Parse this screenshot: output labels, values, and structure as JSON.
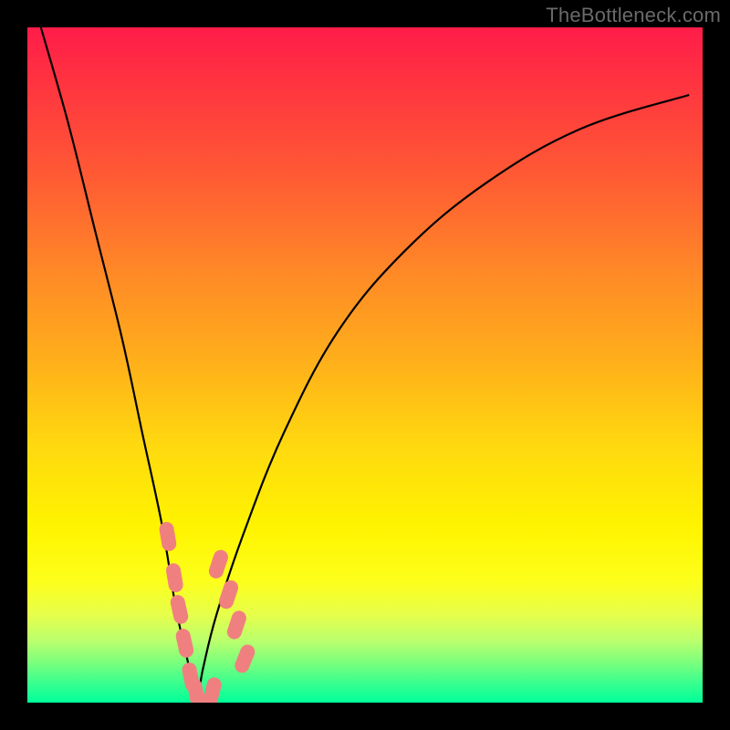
{
  "watermark": "TheBottleneck.com",
  "colors": {
    "background_frame": "#000000",
    "gradient_top": "#ff1c49",
    "gradient_bottom": "#00ff99",
    "curve": "#000000",
    "bead": "#f08080"
  },
  "chart_data": {
    "type": "line",
    "title": "",
    "xlabel": "",
    "ylabel": "",
    "xlim": [
      0,
      100
    ],
    "ylim": [
      0,
      100
    ],
    "grid": false,
    "note": "No numeric tick labels are shown; x/y coordinates are estimated on a 0–100 normalized scale. Minimum of the V-shaped curve is near x≈25 (curve touches bottom).",
    "series": [
      {
        "name": "bottleneck-curve",
        "x": [
          2,
          6,
          10,
          14,
          17,
          20,
          22,
          24,
          25,
          26,
          28,
          32,
          38,
          46,
          56,
          68,
          82,
          98
        ],
        "y": [
          100,
          86,
          70,
          54,
          40,
          26,
          14,
          5,
          0,
          5,
          13,
          25,
          40,
          55,
          67,
          77,
          85,
          90
        ]
      }
    ],
    "markers": [
      {
        "name": "left-arm-beads",
        "shape": "rounded-rect",
        "points": [
          {
            "x": 20.8,
            "y": 24.6
          },
          {
            "x": 21.8,
            "y": 18.5
          },
          {
            "x": 22.5,
            "y": 13.8
          },
          {
            "x": 23.3,
            "y": 8.8
          },
          {
            "x": 24.2,
            "y": 3.8
          }
        ]
      },
      {
        "name": "right-arm-beads",
        "shape": "rounded-rect",
        "points": [
          {
            "x": 28.3,
            "y": 20.5
          },
          {
            "x": 29.8,
            "y": 16.0
          },
          {
            "x": 31.0,
            "y": 11.5
          },
          {
            "x": 32.2,
            "y": 6.5
          }
        ]
      },
      {
        "name": "bottom-beads",
        "shape": "rounded-rect",
        "points": [
          {
            "x": 25.0,
            "y": 1.4
          },
          {
            "x": 27.4,
            "y": 1.6
          }
        ]
      }
    ]
  }
}
